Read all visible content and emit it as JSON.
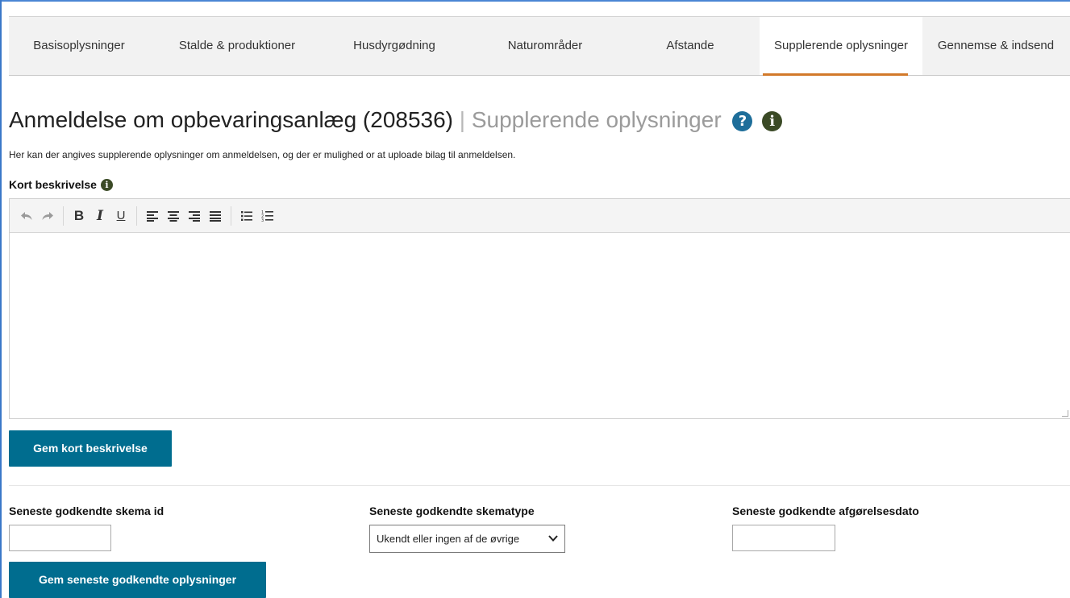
{
  "tabs": [
    {
      "label": "Basisoplysninger",
      "active": false
    },
    {
      "label": "Stalde & produktioner",
      "active": false
    },
    {
      "label": "Husdyrgødning",
      "active": false
    },
    {
      "label": "Naturområder",
      "active": false
    },
    {
      "label": "Afstande",
      "active": false
    },
    {
      "label": "Supplerende oplysninger",
      "active": true
    },
    {
      "label": "Gennemse & indsend",
      "active": false
    }
  ],
  "heading": {
    "title": "Anmeldelse om opbevaringsanlæg (208536)",
    "separator": "|",
    "subtitle": "Supplerende oplysninger",
    "help_glyph": "?",
    "info_glyph": "i"
  },
  "intro_text": "Her kan der angives supplerende oplysninger om anmeldelsen, og der er mulighed or at uploade bilag til anmeldelsen.",
  "short_description": {
    "label": "Kort beskrivelse",
    "info_glyph": "i",
    "value": "",
    "save_button": "Gem kort beskrivelse"
  },
  "toolbar": {
    "icons": [
      "undo-icon",
      "redo-icon",
      "bold-icon",
      "italic-icon",
      "underline-icon",
      "align-left-icon",
      "align-center-icon",
      "align-right-icon",
      "align-justify-icon",
      "bullet-list-icon",
      "numbered-list-icon"
    ],
    "bold": "B",
    "italic": "I",
    "underline": "U"
  },
  "latest_approved": {
    "schema_id_label": "Seneste godkendte skema id",
    "schema_id_value": "",
    "schema_type_label": "Seneste godkendte skematype",
    "schema_type_value": "Ukendt eller ingen af de øvrige",
    "decision_date_label": "Seneste godkendte afgørelsesdato",
    "decision_date_value": "",
    "save_button": "Gem seneste godkendte oplysninger"
  },
  "colors": {
    "primary_button": "#006d8f",
    "active_tab_underline": "#d2792a",
    "help_icon": "#1e6e9a",
    "info_icon": "#3b4a26"
  }
}
